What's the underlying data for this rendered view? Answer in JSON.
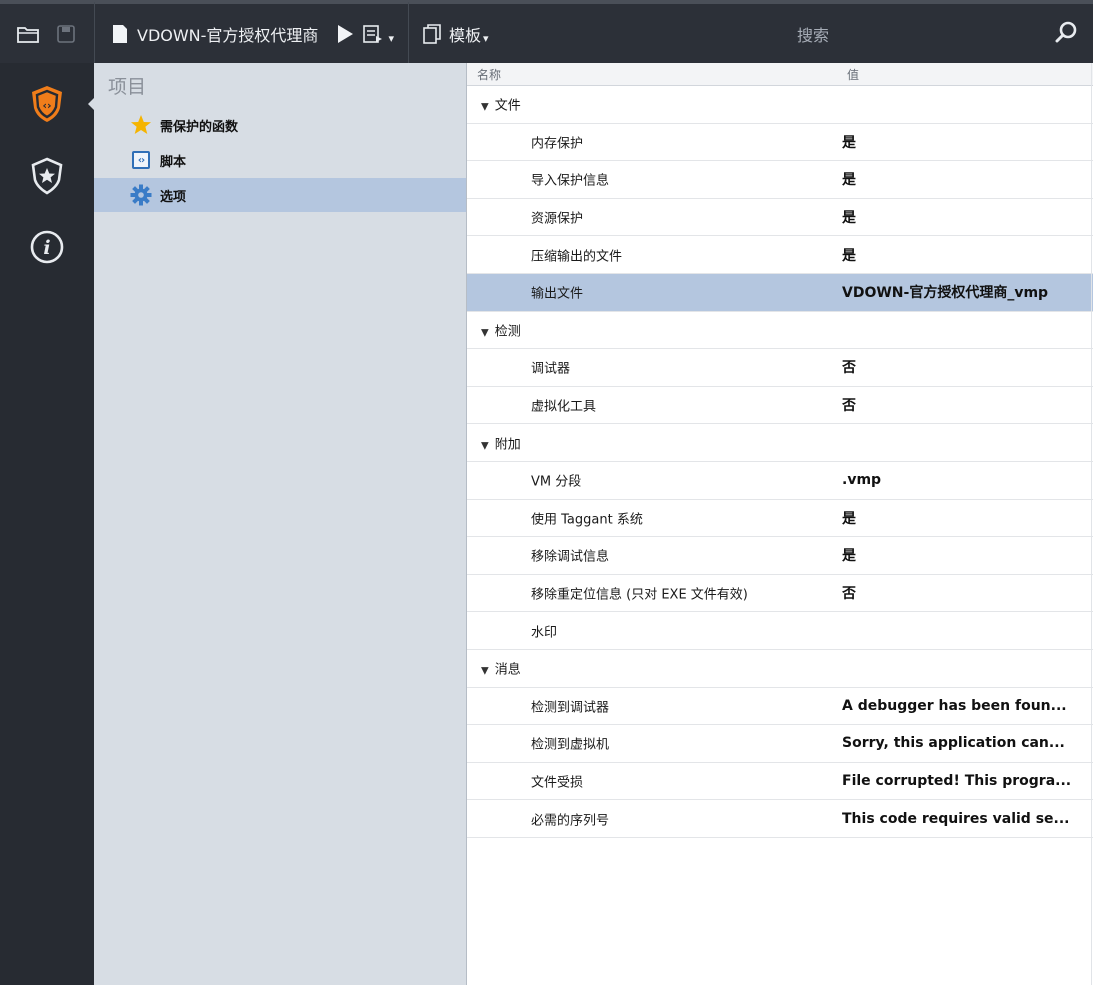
{
  "toolbar": {
    "project_title": "VDOWN-官方授权代理商",
    "template_label": "模板",
    "search_placeholder": "搜索"
  },
  "project_panel": {
    "heading": "项目",
    "items": [
      {
        "label": "需保护的函数",
        "icon": "star-icon"
      },
      {
        "label": "脚本",
        "icon": "script-icon"
      },
      {
        "label": "选项",
        "icon": "gear-icon",
        "selected": true
      }
    ]
  },
  "grid": {
    "header_name": "名称",
    "header_value": "值",
    "rows": [
      {
        "type": "group",
        "name": "文件"
      },
      {
        "type": "prop",
        "name": "内存保护",
        "value": "是"
      },
      {
        "type": "prop",
        "name": "导入保护信息",
        "value": "是"
      },
      {
        "type": "prop",
        "name": "资源保护",
        "value": "是"
      },
      {
        "type": "prop",
        "name": "压缩输出的文件",
        "value": "是"
      },
      {
        "type": "prop",
        "name": "输出文件",
        "value": "VDOWN-官方授权代理商_vmp",
        "selected": true
      },
      {
        "type": "group",
        "name": "检测"
      },
      {
        "type": "prop",
        "name": "调试器",
        "value": "否"
      },
      {
        "type": "prop",
        "name": "虚拟化工具",
        "value": "否"
      },
      {
        "type": "group",
        "name": "附加"
      },
      {
        "type": "prop",
        "name": "VM 分段",
        "value": ".vmp"
      },
      {
        "type": "prop",
        "name": "使用 Taggant 系统",
        "value": "是"
      },
      {
        "type": "prop",
        "name": "移除调试信息",
        "value": "是"
      },
      {
        "type": "prop",
        "name": "移除重定位信息 (只对 EXE 文件有效)",
        "value": "否"
      },
      {
        "type": "prop",
        "name": "水印",
        "value": ""
      },
      {
        "type": "group",
        "name": "消息"
      },
      {
        "type": "prop",
        "name": "检测到调试器",
        "value": "A debugger has been foun..."
      },
      {
        "type": "prop",
        "name": "检测到虚拟机",
        "value": "Sorry, this application can..."
      },
      {
        "type": "prop",
        "name": "文件受损",
        "value": "File corrupted! This progra..."
      },
      {
        "type": "prop",
        "name": "必需的序列号",
        "value": "This code requires valid se..."
      }
    ]
  },
  "colors": {
    "accent": "#f07d1a",
    "selection": "#b4c6df",
    "rail": "#272b32",
    "toolbar": "#2c3038",
    "panel": "#d7dde4"
  }
}
